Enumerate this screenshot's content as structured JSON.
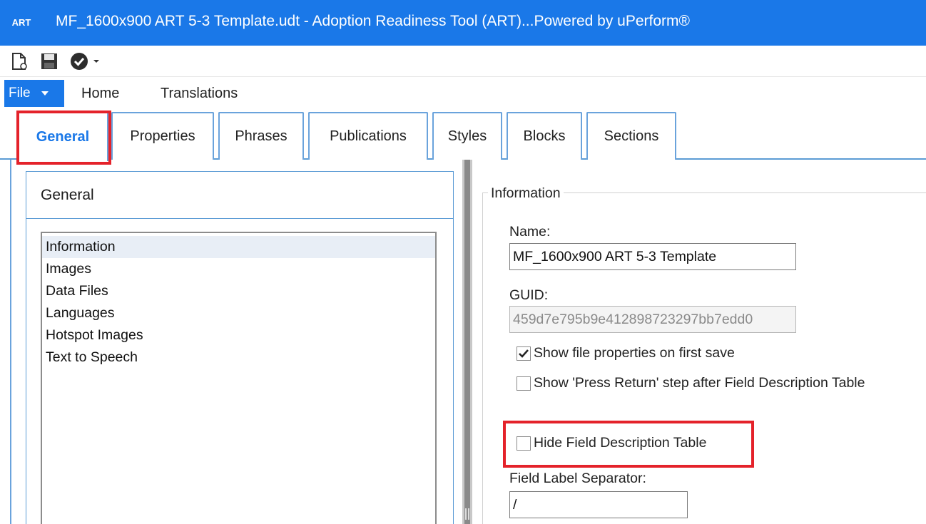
{
  "window": {
    "app_badge": "ART",
    "title": "MF_1600x900 ART 5-3 Template.udt - Adoption Readiness Tool (ART)...Powered by uPerform®"
  },
  "quick_access": {
    "icons": [
      "new-document-icon",
      "save-icon",
      "check-circle-icon",
      "dropdown-arrow-icon"
    ]
  },
  "ribbon": {
    "file_label": "File",
    "tabs": [
      {
        "label": "Home"
      },
      {
        "label": "Translations"
      }
    ]
  },
  "tabs": [
    {
      "label": "General",
      "active": true
    },
    {
      "label": "Properties"
    },
    {
      "label": "Phrases"
    },
    {
      "label": "Publications"
    },
    {
      "label": "Styles"
    },
    {
      "label": "Blocks"
    },
    {
      "label": "Sections"
    }
  ],
  "general_panel": {
    "title": "General",
    "items": [
      {
        "label": "Information",
        "selected": true
      },
      {
        "label": "Images"
      },
      {
        "label": "Data Files"
      },
      {
        "label": "Languages"
      },
      {
        "label": "Hotspot Images"
      },
      {
        "label": "Text to Speech"
      }
    ]
  },
  "information": {
    "legend": "Information",
    "name_label": "Name:",
    "name_value": "MF_1600x900 ART 5-3 Template",
    "guid_label": "GUID:",
    "guid_value": "459d7e795b9e412898723297bb7edd0",
    "show_file_properties": {
      "label": "Show file properties on first save",
      "checked": true
    },
    "show_press_return": {
      "label": "Show 'Press Return' step after Field Description Table",
      "checked": false
    },
    "hide_field_table": {
      "label": "Hide Field Description Table",
      "checked": false
    },
    "separator_label": "Field Label Separator:",
    "separator_value": "/"
  },
  "colors": {
    "accent": "#1a78e8",
    "highlight": "#e4222a",
    "tab_border": "#6aa3dc"
  }
}
